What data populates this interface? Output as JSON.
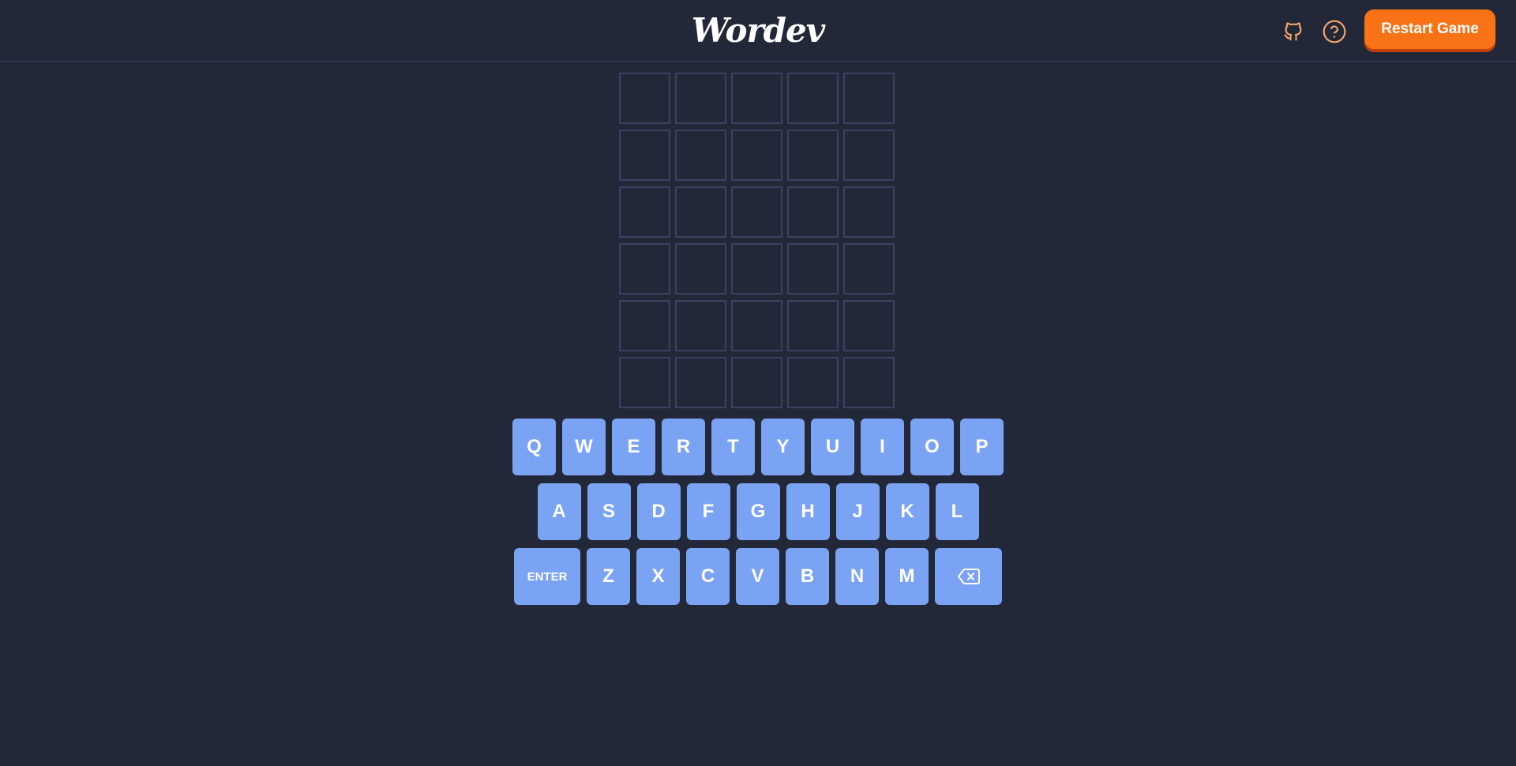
{
  "header": {
    "logo": "Wordev",
    "github_icon": "github-icon",
    "help_icon": "help-circle-icon",
    "restart_label": "Restart Game",
    "accent_color": "#f97316"
  },
  "board": {
    "rows": 6,
    "cols": 5,
    "cells": [
      [
        "",
        "",
        "",
        "",
        ""
      ],
      [
        "",
        "",
        "",
        "",
        ""
      ],
      [
        "",
        "",
        "",
        "",
        ""
      ],
      [
        "",
        "",
        "",
        "",
        ""
      ],
      [
        "",
        "",
        "",
        "",
        ""
      ],
      [
        "",
        "",
        "",
        "",
        ""
      ]
    ]
  },
  "keyboard": {
    "key_color": "#7ba3f4",
    "rows": [
      [
        "Q",
        "W",
        "E",
        "R",
        "T",
        "Y",
        "U",
        "I",
        "O",
        "P"
      ],
      [
        "A",
        "S",
        "D",
        "F",
        "G",
        "H",
        "J",
        "K",
        "L"
      ],
      [
        "ENTER",
        "Z",
        "X",
        "C",
        "V",
        "B",
        "N",
        "M",
        "BACKSPACE"
      ]
    ],
    "enter_label": "ENTER",
    "backspace_icon": "backspace-icon"
  },
  "colors": {
    "background": "#232839",
    "cell_border": "#3b4163"
  }
}
